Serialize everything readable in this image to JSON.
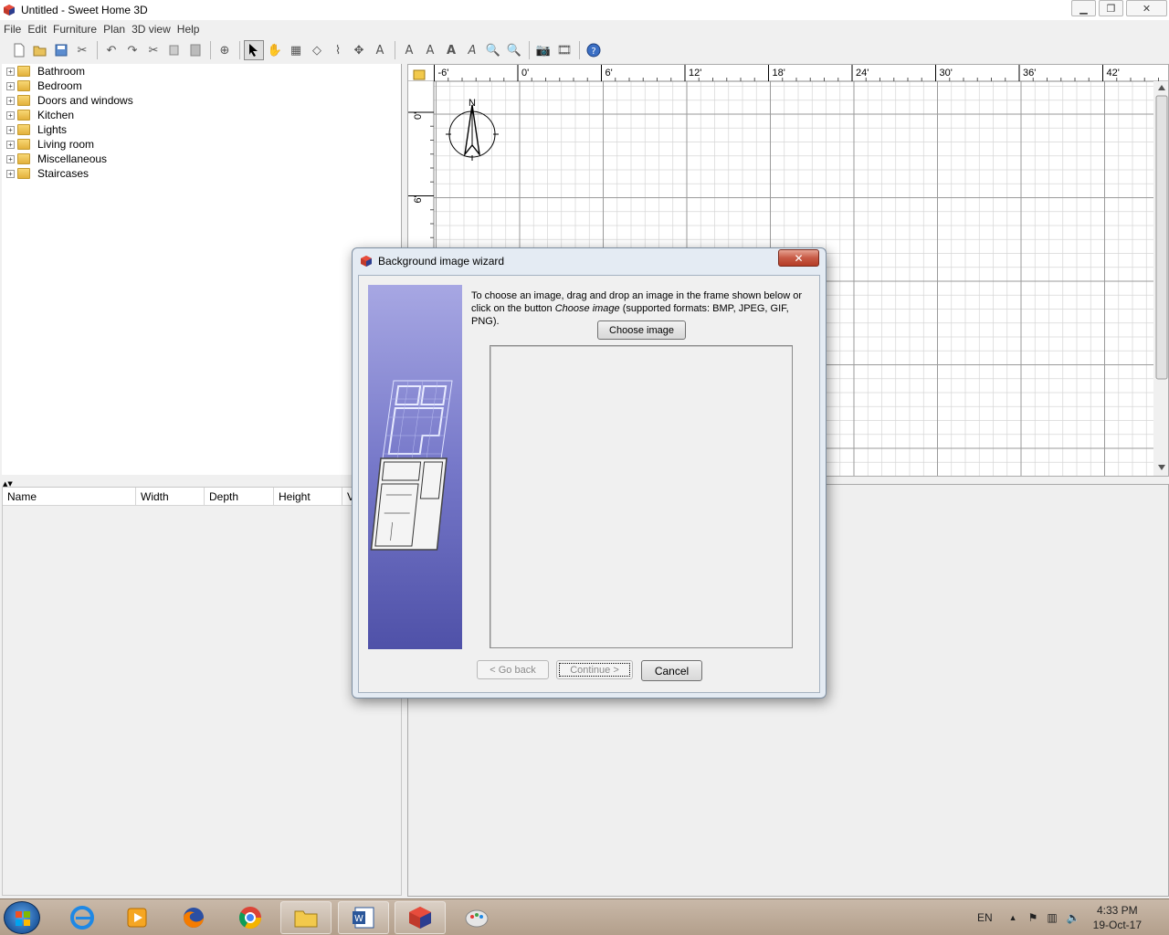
{
  "window": {
    "title": "Untitled - Sweet Home 3D"
  },
  "menu": [
    "File",
    "Edit",
    "Furniture",
    "Plan",
    "3D view",
    "Help"
  ],
  "catalog": {
    "categories": [
      "Bathroom",
      "Bedroom",
      "Doors and windows",
      "Kitchen",
      "Lights",
      "Living room",
      "Miscellaneous",
      "Staircases"
    ]
  },
  "furniture_table": {
    "columns": [
      "Name",
      "Width",
      "Depth",
      "Height",
      "Vi"
    ]
  },
  "plan": {
    "ruler_x": [
      "-6'",
      "0'",
      "6'",
      "12'",
      "18'",
      "24'",
      "30'",
      "36'",
      "42'"
    ],
    "ruler_y": [
      "0'",
      "6'"
    ],
    "compass_label": "N"
  },
  "dialog": {
    "title": "Background image wizard",
    "text_part1": "To choose an image, drag and drop an image in the frame shown below or click on the button ",
    "text_italic": "Choose image",
    "text_part2": " (supported formats: BMP, JPEG, GIF, PNG).",
    "choose_button": "Choose image",
    "back_button": "< Go back",
    "continue_button": "Continue >",
    "cancel_button": "Cancel",
    "close_label": "✕"
  },
  "taskbar": {
    "language": "EN",
    "time": "4:33 PM",
    "date": "19-Oct-17"
  }
}
